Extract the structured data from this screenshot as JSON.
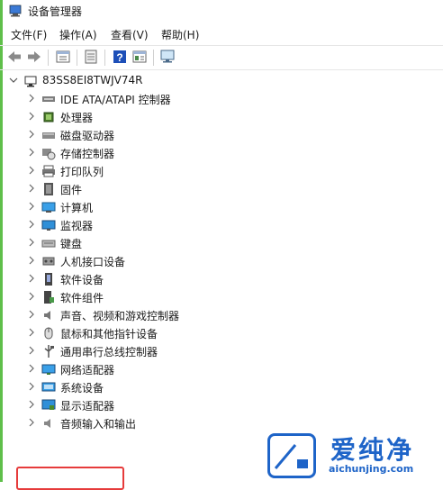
{
  "window": {
    "title": "设备管理器"
  },
  "menu": [
    {
      "label": "文件(F)"
    },
    {
      "label": "操作(A)"
    },
    {
      "label": "查看(V)"
    },
    {
      "label": "帮助(H)"
    }
  ],
  "toolbar": {
    "buttons": [
      "back-arrow-icon",
      "forward-arrow-icon",
      "properties-icon",
      "device-list-icon",
      "help-icon",
      "view-icon",
      "monitor-icon"
    ]
  },
  "tree": {
    "root": "83SS8EI8TWJV74R",
    "categories": [
      {
        "label": "IDE ATA/ATAPI 控制器",
        "icon": "ide-controller-icon"
      },
      {
        "label": "处理器",
        "icon": "processor-icon"
      },
      {
        "label": "磁盘驱动器",
        "icon": "disk-drive-icon"
      },
      {
        "label": "存储控制器",
        "icon": "storage-controller-icon"
      },
      {
        "label": "打印队列",
        "icon": "printer-icon"
      },
      {
        "label": "固件",
        "icon": "firmware-icon"
      },
      {
        "label": "计算机",
        "icon": "computer-icon"
      },
      {
        "label": "监视器",
        "icon": "monitor-icon"
      },
      {
        "label": "键盘",
        "icon": "keyboard-icon"
      },
      {
        "label": "人机接口设备",
        "icon": "hid-icon"
      },
      {
        "label": "软件设备",
        "icon": "software-device-icon"
      },
      {
        "label": "软件组件",
        "icon": "software-component-icon"
      },
      {
        "label": "声音、视频和游戏控制器",
        "icon": "sound-icon"
      },
      {
        "label": "鼠标和其他指针设备",
        "icon": "mouse-icon"
      },
      {
        "label": "通用串行总线控制器",
        "icon": "usb-icon"
      },
      {
        "label": "网络适配器",
        "icon": "network-adapter-icon"
      },
      {
        "label": "系统设备",
        "icon": "system-device-icon"
      },
      {
        "label": "显示适配器",
        "icon": "display-adapter-icon"
      },
      {
        "label": "音频输入和输出",
        "icon": "audio-io-icon"
      }
    ]
  },
  "watermark": {
    "title": "爱纯净",
    "url": "aichunjing.com"
  },
  "colors": {
    "highlight": "#e63b3b",
    "accent": "#1e64c8"
  }
}
